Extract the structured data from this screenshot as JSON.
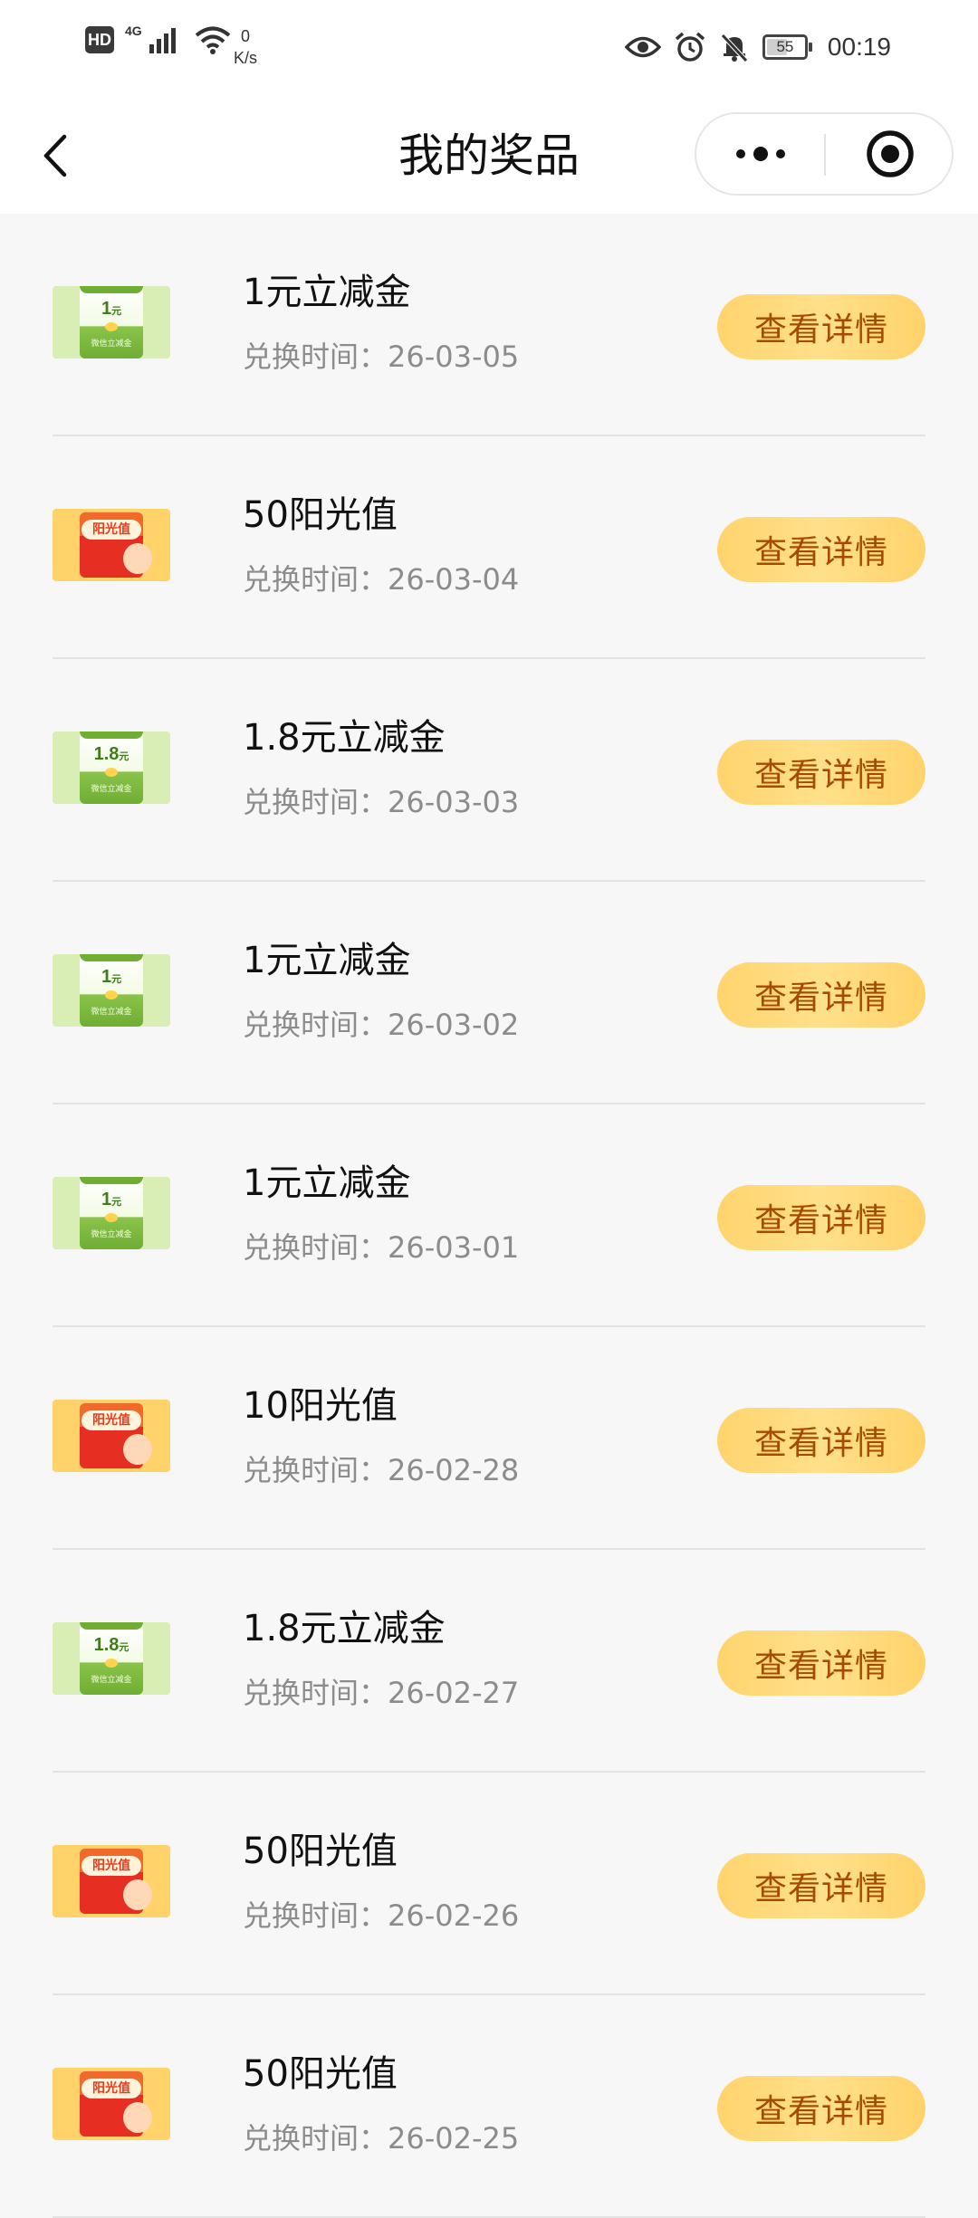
{
  "status_bar": {
    "hd": "HD",
    "network": "4G",
    "speed_value": "0",
    "speed_unit": "K/s",
    "battery": "55",
    "battery_level": 0.55,
    "time": "00:19"
  },
  "nav": {
    "title": "我的奖品"
  },
  "thumb_labels": {
    "voucher_caption": "微信立减金",
    "sunshine_label": "阳光值"
  },
  "prizes": [
    {
      "name": "1元立减金",
      "time_label": "兑换时间：",
      "time": "26-03-05",
      "button": "查看详情",
      "thumb": "voucher",
      "thumb_amount": "1",
      "thumb_unit": "元"
    },
    {
      "name": "50阳光值",
      "time_label": "兑换时间：",
      "time": "26-03-04",
      "button": "查看详情",
      "thumb": "sunshine"
    },
    {
      "name": "1.8元立减金",
      "time_label": "兑换时间：",
      "time": "26-03-03",
      "button": "查看详情",
      "thumb": "voucher",
      "thumb_amount": "1.8",
      "thumb_unit": "元"
    },
    {
      "name": "1元立减金",
      "time_label": "兑换时间：",
      "time": "26-03-02",
      "button": "查看详情",
      "thumb": "voucher",
      "thumb_amount": "1",
      "thumb_unit": "元"
    },
    {
      "name": "1元立减金",
      "time_label": "兑换时间：",
      "time": "26-03-01",
      "button": "查看详情",
      "thumb": "voucher",
      "thumb_amount": "1",
      "thumb_unit": "元"
    },
    {
      "name": "10阳光值",
      "time_label": "兑换时间：",
      "time": "26-02-28",
      "button": "查看详情",
      "thumb": "sunshine"
    },
    {
      "name": "1.8元立减金",
      "time_label": "兑换时间：",
      "time": "26-02-27",
      "button": "查看详情",
      "thumb": "voucher",
      "thumb_amount": "1.8",
      "thumb_unit": "元"
    },
    {
      "name": "50阳光值",
      "time_label": "兑换时间：",
      "time": "26-02-26",
      "button": "查看详情",
      "thumb": "sunshine"
    },
    {
      "name": "50阳光值",
      "time_label": "兑换时间：",
      "time": "26-02-25",
      "button": "查看详情",
      "thumb": "sunshine"
    }
  ],
  "colors": {
    "background": "#f7f7f7",
    "button_bg": "#ffd46e",
    "button_text": "#a54a00",
    "secondary_text": "#8c8c8c"
  }
}
